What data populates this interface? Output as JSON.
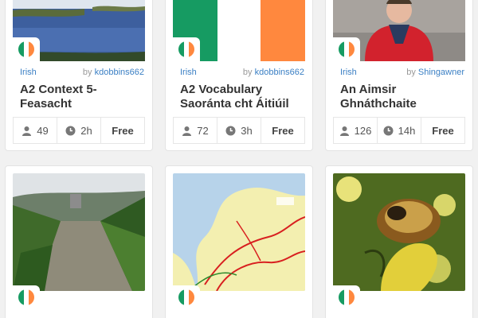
{
  "cards": [
    {
      "language": "Irish",
      "by_prefix": "by",
      "author": "kdobbins662",
      "title": "A2 Context 5-\nFeasacht",
      "learners": "49",
      "time": "2h",
      "price": "Free"
    },
    {
      "language": "Irish",
      "by_prefix": "by",
      "author": "kdobbins662",
      "title": "A2 Vocabulary\nSaoránta cht Áitiúil",
      "learners": "72",
      "time": "3h",
      "price": "Free"
    },
    {
      "language": "Irish",
      "by_prefix": "by",
      "author": "Shingawner",
      "title": "An Aimsir\nGhnáthchaite",
      "learners": "126",
      "time": "14h",
      "price": "Free"
    },
    {
      "language": "",
      "by_prefix": "",
      "author": "",
      "title": "",
      "learners": "",
      "time": "",
      "price": ""
    },
    {
      "language": "",
      "by_prefix": "",
      "author": "",
      "title": "",
      "learners": "",
      "time": "",
      "price": ""
    },
    {
      "language": "",
      "by_prefix": "",
      "author": "",
      "title": "",
      "learners": "",
      "time": "",
      "price": ""
    }
  ],
  "flag_colors": {
    "green": "#169b62",
    "white": "#ffffff",
    "orange": "#ff883e"
  },
  "icons": {
    "learners": "person-icon",
    "time": "clock-icon"
  }
}
